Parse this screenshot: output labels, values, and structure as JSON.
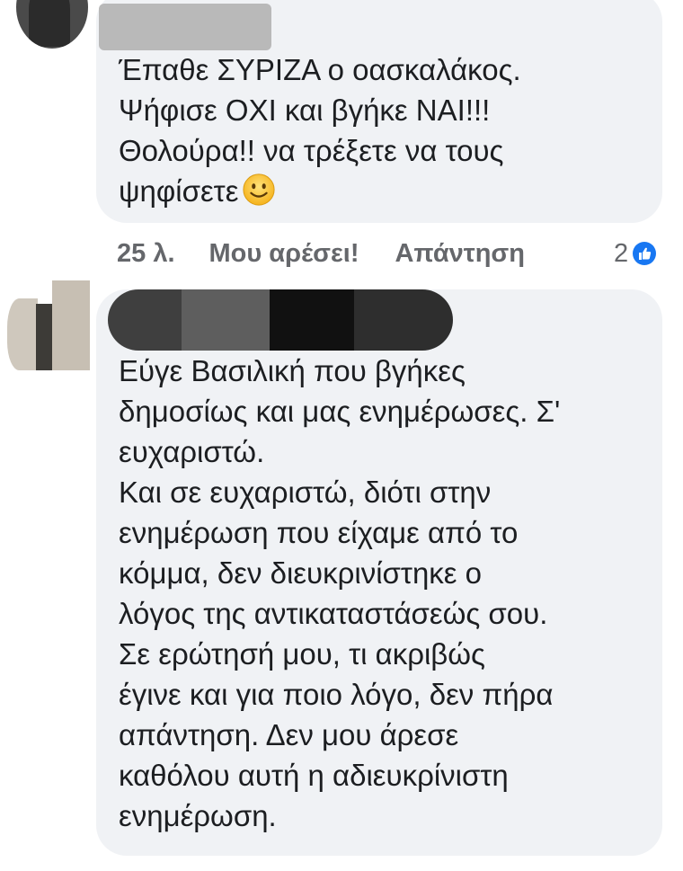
{
  "comments": [
    {
      "text": "Έπαθε ΣΥΡΙΖΑ ο οασκαλάκος.\nΨήφισε ΟΧΙ και βγήκε ΝΑΙ!!!\nΘολούρα!! να τρέξετε να τους\nψηφίσετε",
      "emoji": "smiling-face",
      "time": "25 λ.",
      "like_label": "Μου αρέσει!",
      "reply_label": "Απάντηση",
      "reaction_count": "2",
      "reaction_type": "like-icon"
    },
    {
      "text": "Εύγε Βασιλική που βγήκες\nδημοσίως και μας ενημέρωσες. Σ'\nευχαριστώ.\nΚαι σε ευχαριστώ, διότι στην\nενημέρωση που είχαμε από το\nκόμμα, δεν διευκρινίστηκε ο\nλόγος της αντικαταστάσεώς σου.\nΣε ερώτησή μου, τι ακριβώς\nέγινε και για ποιο λόγο, δεν πήρα\nαπάντηση. Δεν μου άρεσε\nκαθόλου αυτή η αδιευκρίνιστη\nενημέρωση."
    }
  ],
  "colors": {
    "bubble": "#f0f2f5",
    "meta_text": "#65676b",
    "like_blue": "#1877f2",
    "text": "#1c1e21"
  }
}
